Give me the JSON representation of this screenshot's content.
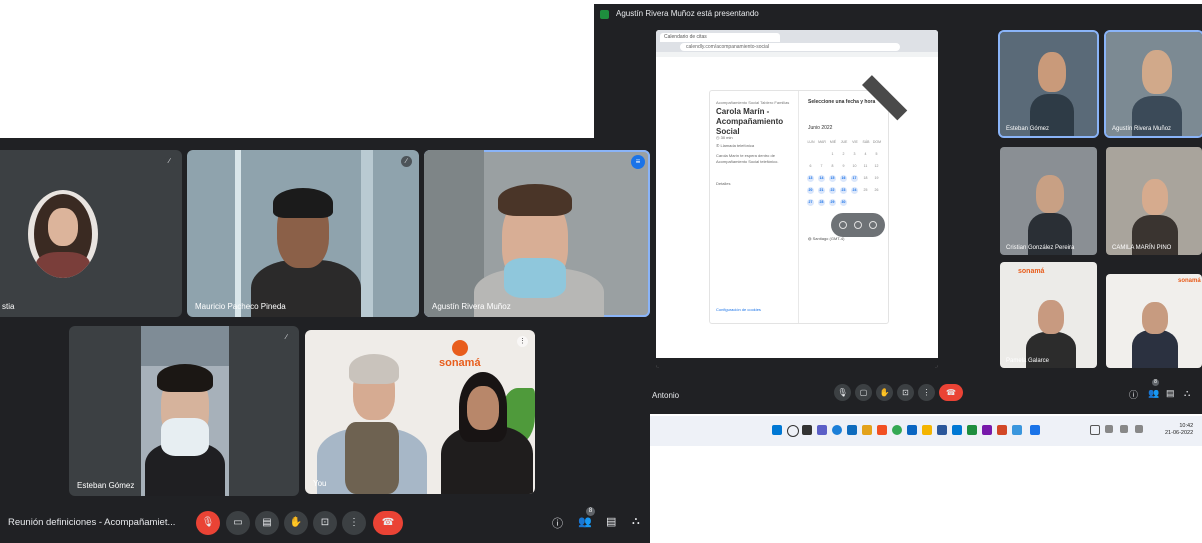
{
  "back_window": {
    "presenter_banner": "Agustín Rivera Muñoz está presentando",
    "shared_page": {
      "tab_label": "Calendario de citas",
      "url": "calendly.com/acompanamiento-social",
      "organizer": "Acompañamiento Social Tablero Familias",
      "event_title": "Carola Marín - Acompañamiento Social",
      "duration": "30 min",
      "mode": "Llamada telefónica",
      "description": "Carola Marín te espera dentro de Acompañamiento Social telefónico.",
      "details_label": "Detalles",
      "select_label": "Seleccione una fecha y hora",
      "month": "Junio 2022",
      "weekdays": [
        "LUN",
        "MAR",
        "MIÉ",
        "JUE",
        "VIE",
        "SÁB",
        "DOM"
      ],
      "timezone": "Santiago (GMT-4)",
      "cookie_link": "Configuración de cookies",
      "ribbon": "Calendly"
    },
    "participants": [
      {
        "name": "Esteban Gómez"
      },
      {
        "name": "Agustín Rivera Muñoz"
      },
      {
        "name": "Cristian González Pereira"
      },
      {
        "name": "CAMILA MARÍN PINO"
      },
      {
        "name": "Pamela Galarce"
      },
      {
        "name": ""
      }
    ],
    "meeting_name": "Antonio",
    "participant_count": "8"
  },
  "taskbar": {
    "time": "10:42",
    "date": "21-06-2022"
  },
  "front_window": {
    "tiles": [
      {
        "name": "stia"
      },
      {
        "name": "Mauricio Pacheco Pineda"
      },
      {
        "name": "Agustín Rivera Muñoz"
      },
      {
        "name": "Esteban Gómez"
      },
      {
        "name": "You"
      }
    ],
    "logo_text": "sonamá",
    "meeting_title": "Reunión definiciones - Acompañamiet...",
    "participant_count": "8"
  },
  "colors": {
    "meet_bg": "#202124",
    "tile_bg": "#3c4043",
    "active_outline": "#8ab4f8",
    "end_call_red": "#ea4335",
    "logo_orange": "#e85d1c"
  }
}
